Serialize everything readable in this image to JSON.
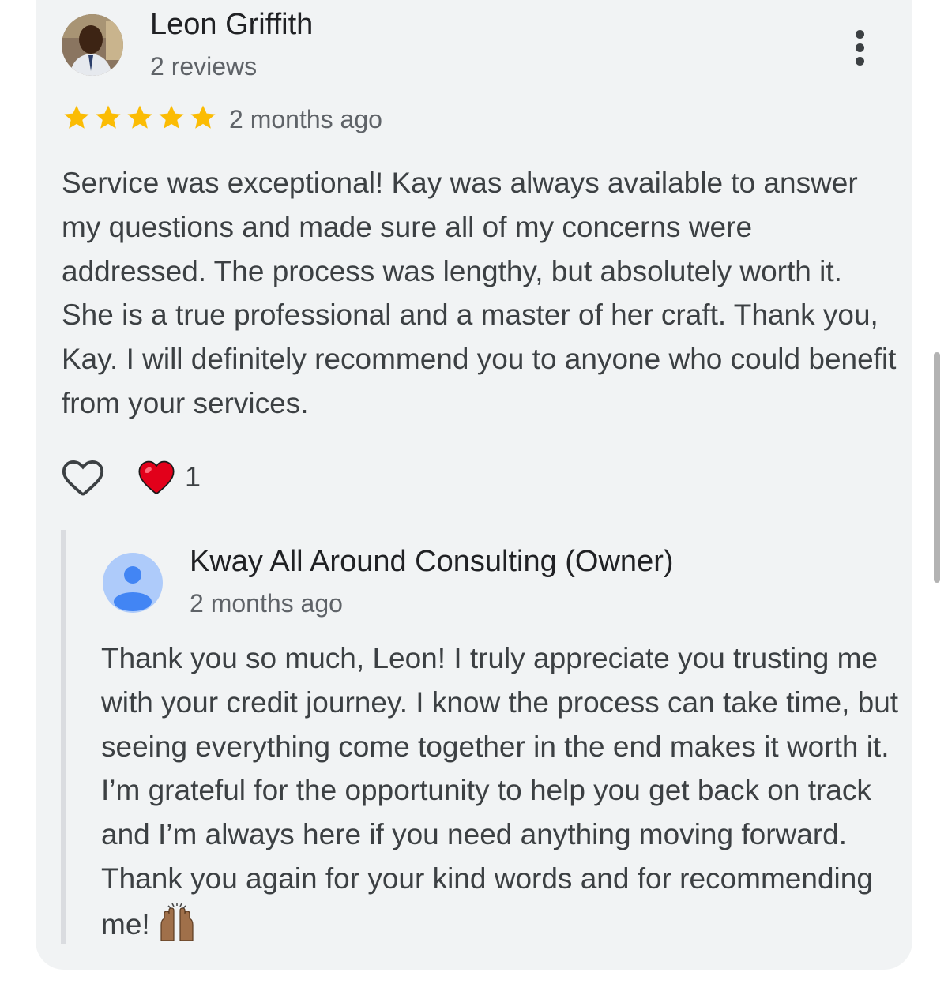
{
  "review": {
    "reviewer_name": "Leon Griffith",
    "reviewer_reviews": "2 reviews",
    "rating": 5,
    "rating_max": 5,
    "time": "2 months ago",
    "text": "Service was exceptional! Kay was always available to answer my questions and made sure all of my concerns were addressed. The process was lengthy, but absolutely worth it. She is a true professional and a master of her craft. Thank you, Kay. I will definitely recommend you to anyone who could benefit from your services.",
    "reaction_count": "1",
    "reaction_icon": "red-heart-emoji",
    "like_icon": "heart-outline-icon"
  },
  "owner_reply": {
    "name": "Kway All Around Consulting (Owner)",
    "time": "2 months ago",
    "text": "Thank you so much, Leon! I truly appreciate you trusting me with your credit journey. I know the process can take time, but seeing everything come together in the end makes it worth it. I’m grateful for the opportunity to help you get back on track and I’m always here if you need anything moving forward. Thank you again for your kind words and for recommending me!",
    "trailing_emoji": "raising-hands-emoji"
  },
  "colors": {
    "card_background": "#f1f3f4",
    "star": "#fbbc04",
    "default_avatar": "#4285f4",
    "heart": "#e2001a"
  }
}
